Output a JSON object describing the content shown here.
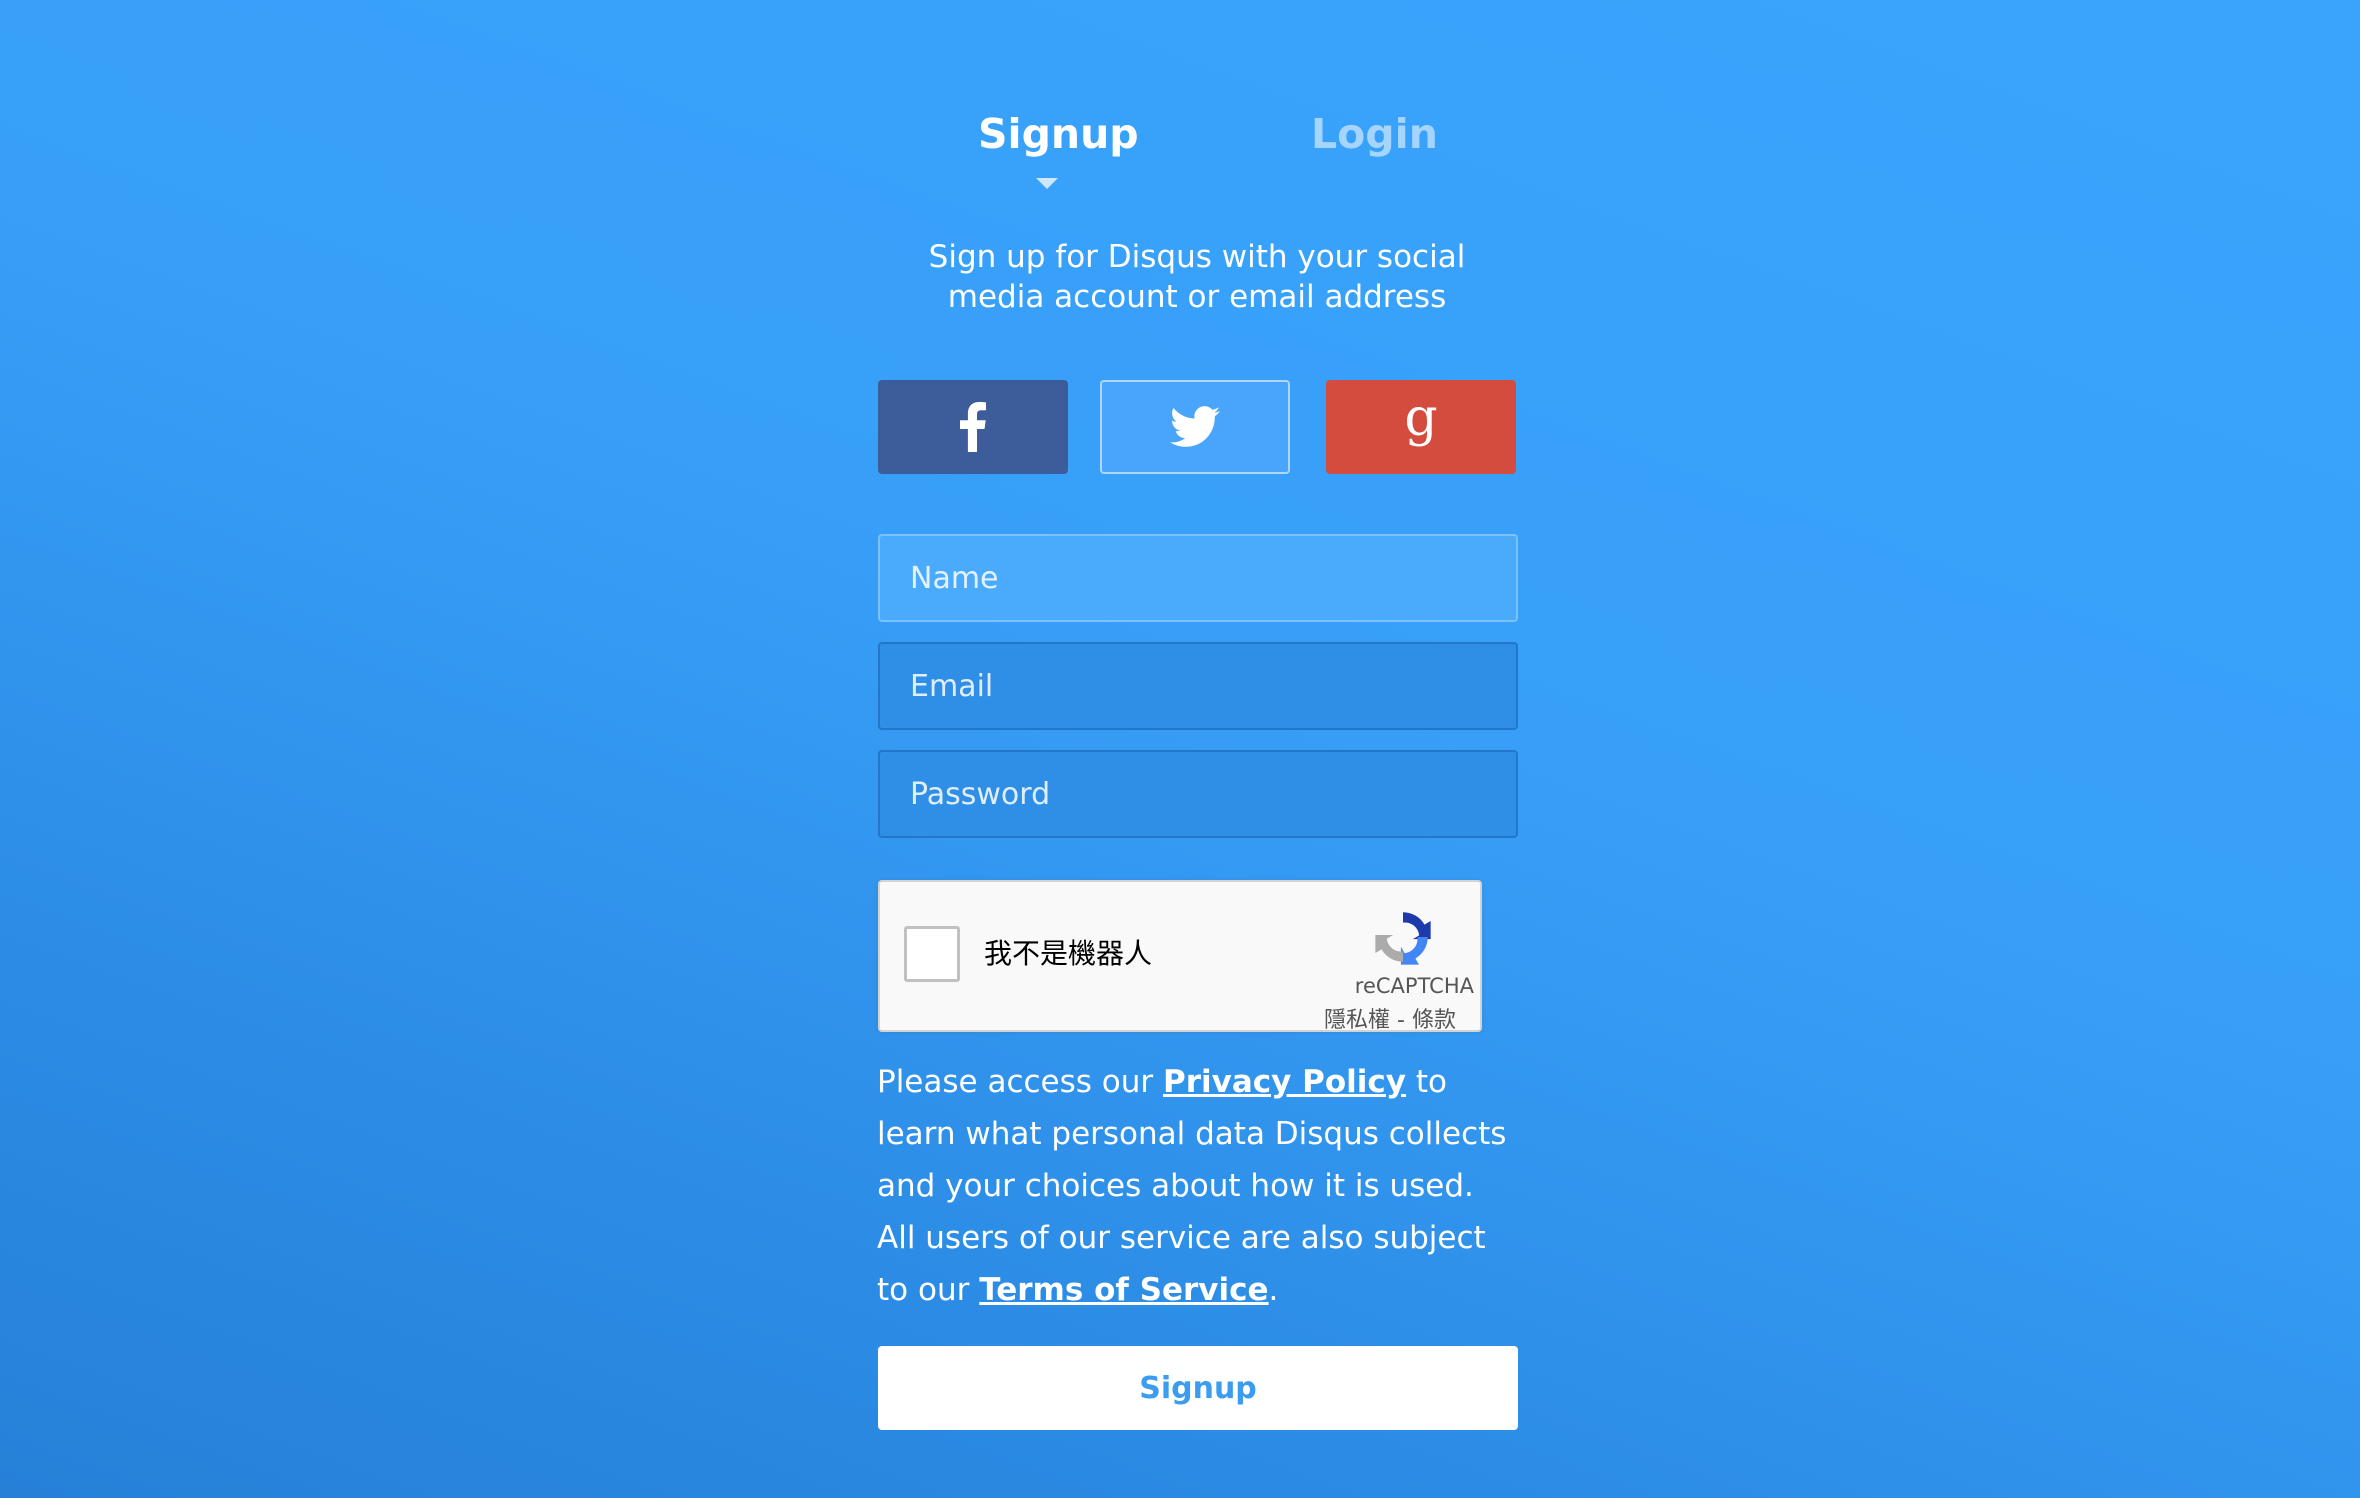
{
  "tabs": {
    "signup": "Signup",
    "login": "Login"
  },
  "subtitle": "Sign up for Disqus with your social media account or email address",
  "social": {
    "facebook": {
      "icon": "facebook-icon",
      "color": "#3d5c9a"
    },
    "twitter": {
      "icon": "twitter-icon",
      "color": "#48a5fb"
    },
    "google": {
      "icon": "google-icon",
      "color": "#d44c3d"
    }
  },
  "form": {
    "name_placeholder": "Name",
    "email_placeholder": "Email",
    "password_placeholder": "Password"
  },
  "recaptcha": {
    "label": "我不是機器人",
    "brand": "reCAPTCHA",
    "privacy": "隱私權",
    "separator": " - ",
    "terms": "條款"
  },
  "notice": {
    "part1": "Please access our ",
    "privacy_link": "Privacy Policy",
    "part2": " to learn what personal data Disqus collects and your choices about how it is used. All users of our service are also subject to our ",
    "terms_link": "Terms of Service",
    "part3": "."
  },
  "submit_label": "Signup",
  "colors": {
    "background": "#379ff8",
    "accent": "#3b9cf0"
  }
}
